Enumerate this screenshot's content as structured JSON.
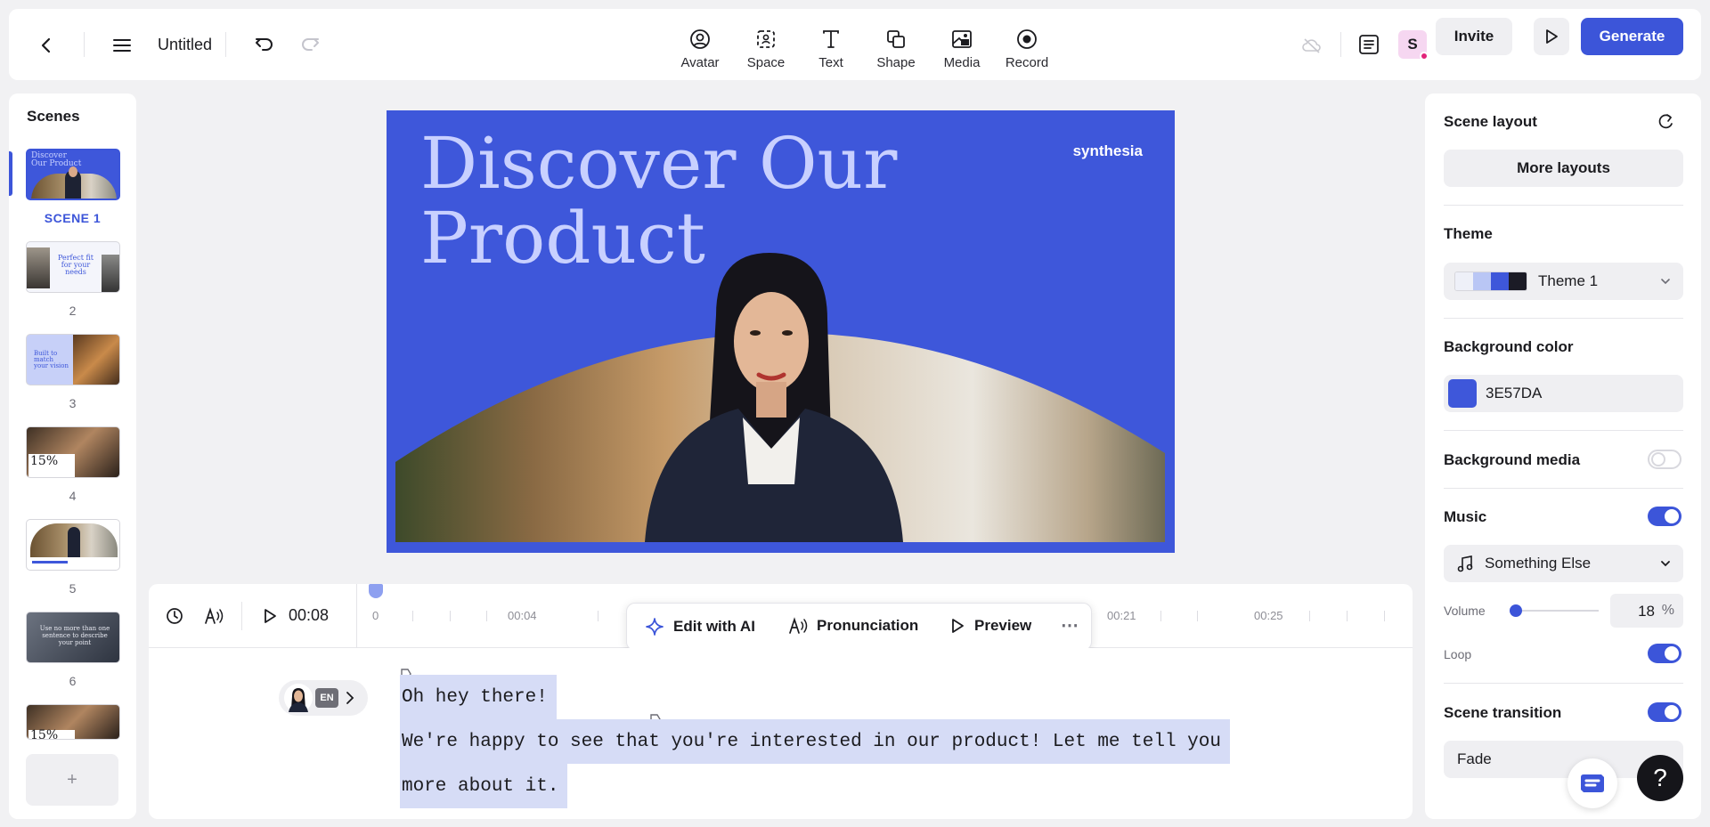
{
  "header": {
    "title": "Untitled",
    "tools": [
      {
        "label": "Avatar",
        "icon": "avatar-icon"
      },
      {
        "label": "Space",
        "icon": "space-icon"
      },
      {
        "label": "Text",
        "icon": "text-icon"
      },
      {
        "label": "Shape",
        "icon": "shape-icon"
      },
      {
        "label": "Media",
        "icon": "media-icon"
      },
      {
        "label": "Record",
        "icon": "record-icon"
      }
    ],
    "user_initial": "S",
    "invite_label": "Invite",
    "generate_label": "Generate"
  },
  "scenes": {
    "title": "Scenes",
    "items": [
      {
        "label": "SCENE 1",
        "active": true
      },
      {
        "label": "2"
      },
      {
        "label": "3"
      },
      {
        "label": "4"
      },
      {
        "label": "5"
      },
      {
        "label": "6"
      }
    ],
    "thumb_texts": {
      "s1": "Discover Our Product",
      "s2": "Perfect fit for your needs",
      "s3": "Built to match your vision",
      "s4": "15%",
      "s6": "Use no more than one sentence to describe your point",
      "s7": "15%"
    },
    "add_label": "+"
  },
  "canvas": {
    "title_line1": "Discover Our",
    "title_line2": "Product",
    "brand": "synthesia",
    "bg_color": "#3E57DA"
  },
  "timeline": {
    "current_time": "00:08",
    "ticks": [
      "0",
      "00:04",
      "00:21",
      "00:25"
    ],
    "ai_bar": {
      "edit_label": "Edit with AI",
      "pronunciation_label": "Pronunciation",
      "preview_label": "Preview"
    }
  },
  "script": {
    "language": "EN",
    "lines": [
      "Oh hey there!",
      "We're happy to see that you're interested in our product! Let me tell you",
      "more about it."
    ]
  },
  "panel": {
    "scene_layout": "Scene layout",
    "more_layouts": "More layouts",
    "theme_heading": "Theme",
    "theme_value": "Theme 1",
    "theme_colors": [
      "#eef0f8",
      "#b9c6f5",
      "#3e57da",
      "#1b1b26"
    ],
    "bg_color_heading": "Background color",
    "bg_color_value": "3E57DA",
    "bg_media_heading": "Background media",
    "bg_media_on": false,
    "music_heading": "Music",
    "music_on": true,
    "music_value": "Something Else",
    "volume_label": "Volume",
    "volume_value": "18",
    "volume_unit": "%",
    "volume_fraction": 0.07,
    "loop_label": "Loop",
    "loop_on": true,
    "transition_heading": "Scene transition",
    "transition_on": true,
    "transition_value": "Fade"
  },
  "colors": {
    "accent": "#3C55D9",
    "selection": "#D6DCF6"
  }
}
